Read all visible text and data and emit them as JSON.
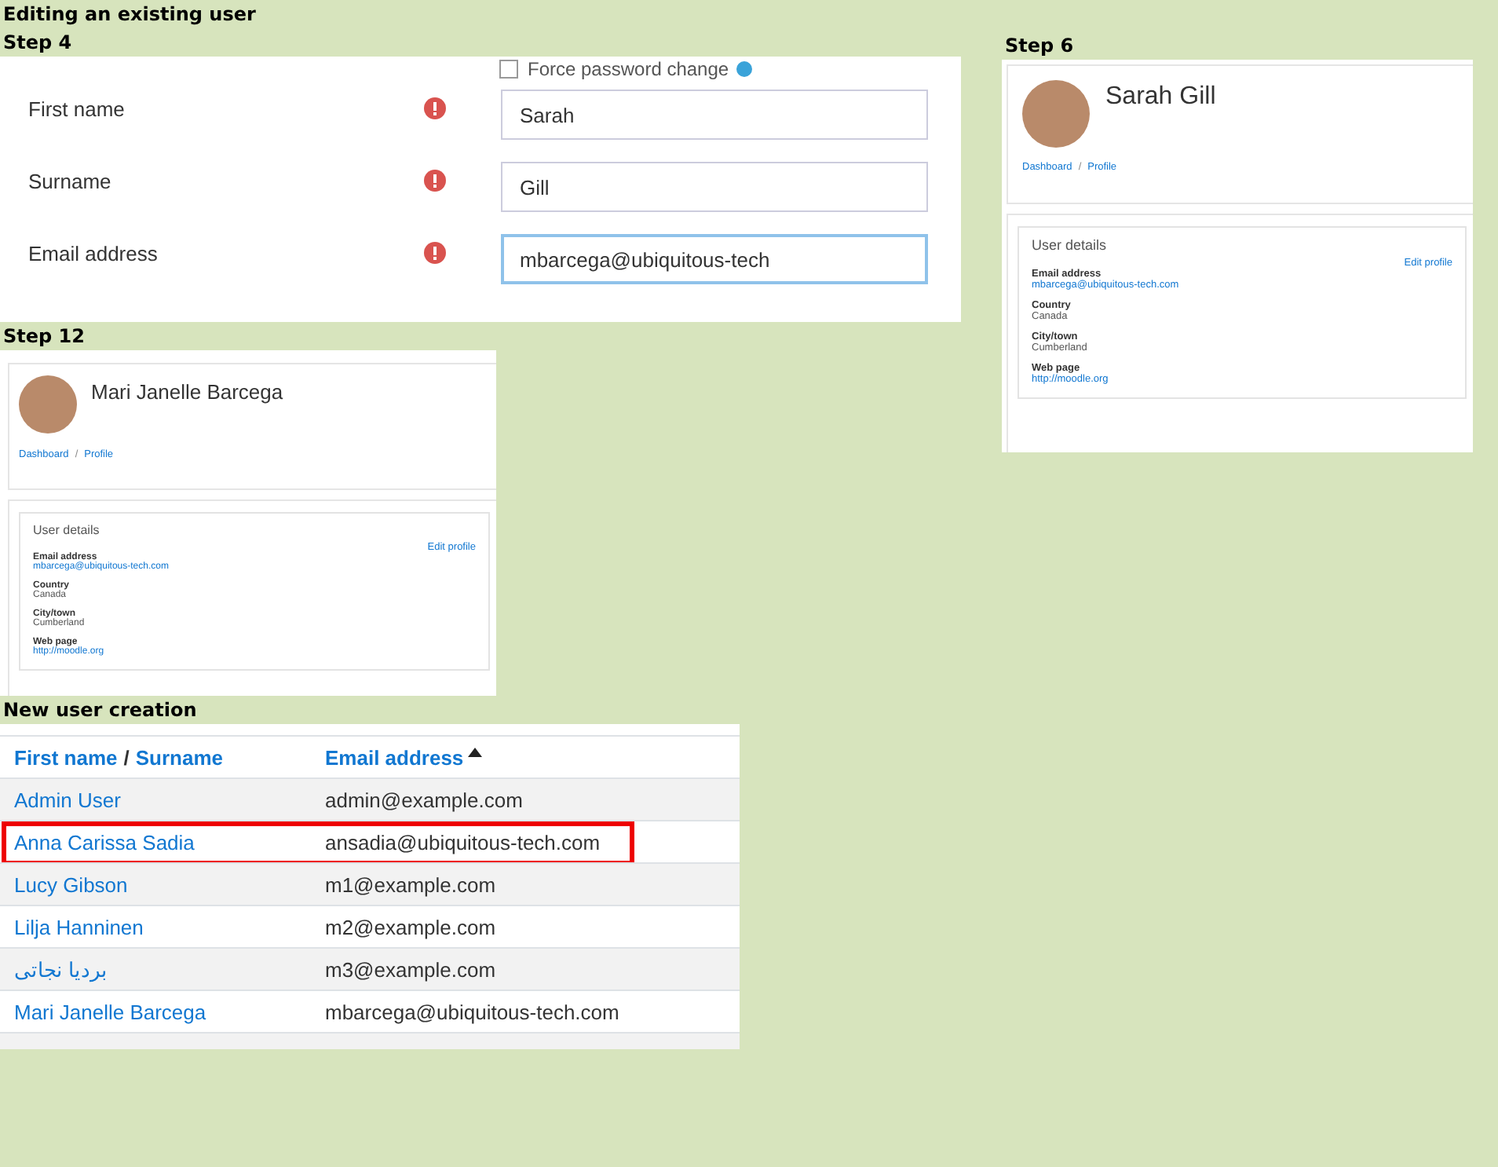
{
  "heading": "Editing an existing user",
  "step4": {
    "label": "Step  4",
    "checkbox": {
      "label": "Force password change",
      "checked": false
    },
    "fields": [
      {
        "label": "First name",
        "value": "Sarah",
        "required": true,
        "focused": false
      },
      {
        "label": "Surname",
        "value": "Gill",
        "required": true,
        "focused": false
      },
      {
        "label": "Email address",
        "value": "mbarcega@ubiquitous-tech",
        "required": true,
        "focused": true
      }
    ]
  },
  "profiles": [
    {
      "label": "Step 12",
      "name": "Mari Janelle Barcega",
      "breadcrumb": [
        "Dashboard",
        "Profile"
      ],
      "breadcrumb_separator": "/",
      "section_title": "User details",
      "edit_link": "Edit profile",
      "details": [
        {
          "label": "Email address",
          "value": "mbarcega@ubiquitous-tech.com",
          "link": true
        },
        {
          "label": "Country",
          "value": "Canada",
          "link": false
        },
        {
          "label": "City/town",
          "value": "Cumberland",
          "link": false
        },
        {
          "label": "Web page",
          "value": "http://moodle.org",
          "link": true
        }
      ]
    },
    {
      "label": "Step 6",
      "name": "Sarah Gill",
      "breadcrumb": [
        "Dashboard",
        "Profile"
      ],
      "breadcrumb_separator": "/",
      "section_title": "User details",
      "edit_link": "Edit profile",
      "details": [
        {
          "label": "Email address",
          "value": "mbarcega@ubiquitous-tech.com",
          "link": true
        },
        {
          "label": "Country",
          "value": "Canada",
          "link": false
        },
        {
          "label": "City/town",
          "value": "Cumberland",
          "link": false
        },
        {
          "label": "Web page",
          "value": "http://moodle.org",
          "link": true
        }
      ]
    }
  ],
  "new_user": {
    "label": "New user creation",
    "columns": [
      {
        "parts": [
          "First name",
          "Surname"
        ],
        "separator": "/",
        "sorted": false
      },
      {
        "parts": [
          "Email address"
        ],
        "sorted": true
      }
    ],
    "rows": [
      {
        "name": "Admin User",
        "email": "admin@example.com",
        "highlighted": false
      },
      {
        "name": "Anna Carissa Sadia",
        "email": "ansadia@ubiquitous-tech.com",
        "highlighted": true
      },
      {
        "name": "Lucy Gibson",
        "email": "m1@example.com",
        "highlighted": false
      },
      {
        "name": "Lilja Hanninen",
        "email": "m2@example.com",
        "highlighted": false
      },
      {
        "name": "بردیا نجاتی",
        "email": "m3@example.com",
        "highlighted": false
      },
      {
        "name": "Mari Janelle Barcega",
        "email": "mbarcega@ubiquitous-tech.com",
        "highlighted": false
      }
    ]
  }
}
